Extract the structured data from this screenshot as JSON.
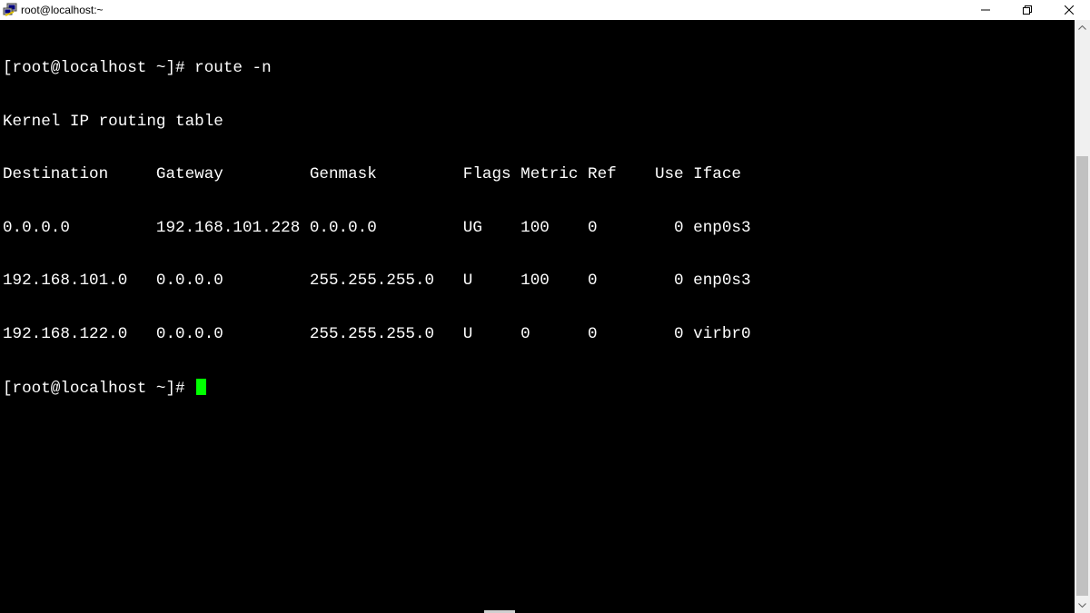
{
  "window": {
    "title": "root@localhost:~",
    "icons": {
      "app": "putty-icon",
      "minimize": "minimize-icon",
      "restore": "restore-icon",
      "close": "close-icon"
    }
  },
  "terminal": {
    "colors": {
      "background": "#000000",
      "text": "#ffffff",
      "cursor": "#00ff00"
    },
    "prompt": "[root@localhost ~]#",
    "command": "route -n",
    "output_heading": "Kernel IP routing table",
    "table_header": "Destination     Gateway         Genmask         Flags Metric Ref    Use Iface",
    "rows": [
      "0.0.0.0         192.168.101.228 0.0.0.0         UG    100    0        0 enp0s3",
      "192.168.101.0   0.0.0.0         255.255.255.0   U     100    0        0 enp0s3",
      "192.168.122.0   0.0.0.0         255.255.255.0   U     0      0        0 virbr0"
    ],
    "final_prompt": "[root@localhost ~]#"
  },
  "scrollbar": {
    "icons": {
      "up": "scroll-up-arrow-icon",
      "down": "scroll-down-arrow-icon"
    }
  }
}
